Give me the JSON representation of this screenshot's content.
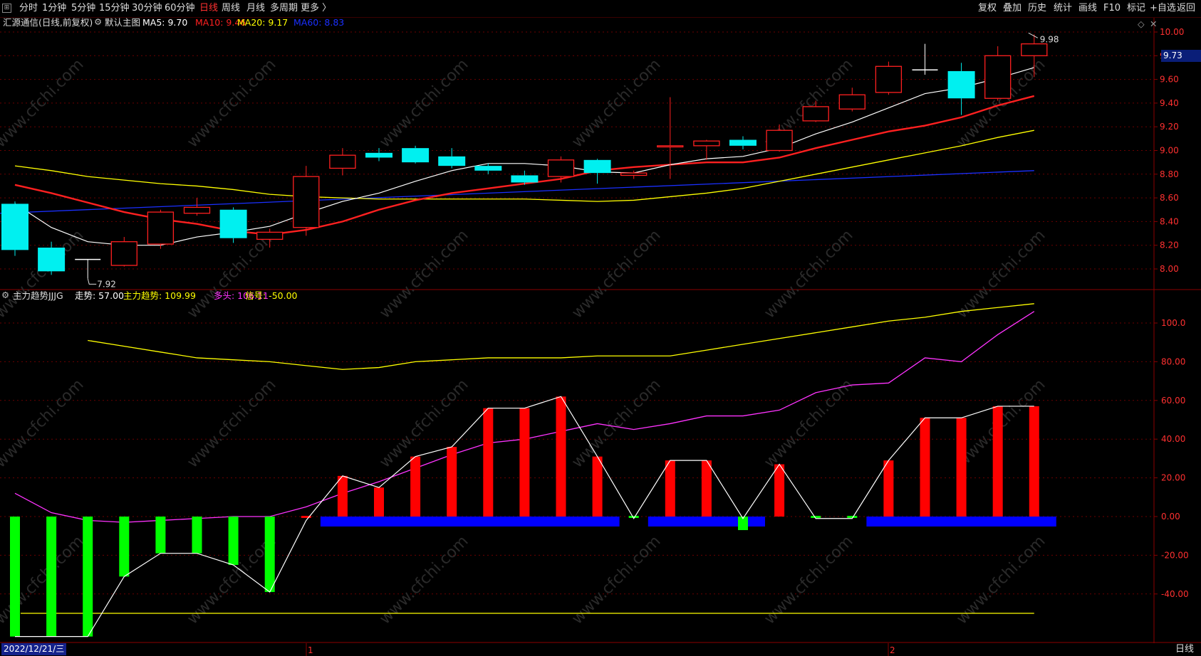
{
  "toolbar": {
    "periods": [
      "分时",
      "1分钟",
      "5分钟",
      "15分钟",
      "30分钟",
      "60分钟",
      "日线",
      "周线",
      "月线",
      "多周期",
      "更多 〉"
    ],
    "active_period": "日线",
    "right_items": [
      "复权",
      "叠加",
      "历史",
      "统计",
      "画线",
      "F10",
      "标记",
      "+自选",
      "返回"
    ]
  },
  "main_panel": {
    "title": "汇源通信(日线,前复权)",
    "indicator_name": "默认主图",
    "ma": [
      {
        "label": "MA5: 9.70",
        "color": "#ffffff"
      },
      {
        "label": "MA10: 9.46",
        "color": "#ff2020"
      },
      {
        "label": "MA20: 9.17",
        "color": "#ffff00"
      },
      {
        "label": "MA60: 8.83",
        "color": "#1a30ff"
      }
    ],
    "price_ticks": [
      "10.00",
      "9.80",
      "9.60",
      "9.40",
      "9.20",
      "9.00",
      "8.80",
      "8.60",
      "8.40",
      "8.20",
      "8.00"
    ],
    "current_price": "9.73",
    "high_mark": "9.98",
    "low_mark": "7.92"
  },
  "sub_panel": {
    "indicator_name": "主力趋势JJJG",
    "labels": [
      {
        "label": "走势: 57.00",
        "color": "#ffffff"
      },
      {
        "label": "主力趋势: 109.99",
        "color": "#ffff00"
      },
      {
        "label": "多头: 106.11",
        "color": "#ff33ff"
      },
      {
        "label": "信号: -50.00",
        "color": "#ffff00"
      }
    ],
    "ticks": [
      "100.0",
      "80.00",
      "60.00",
      "40.00",
      "20.00",
      "0.00",
      "-20.00",
      "-40.00"
    ]
  },
  "footer": {
    "date": "2022/12/21/三",
    "month_marks": [
      "1",
      "2"
    ],
    "period_tab": "日线"
  },
  "watermark": "www.cfchi.com",
  "colors": {
    "up": "#ff2020",
    "down": "#00f0f0",
    "bg": "#000000",
    "grid": "#6b0000",
    "pos_bar": "#ff0000",
    "neg_bar": "#00ff00",
    "signal_bar": "#0000ff"
  },
  "chart_data": {
    "type": "candlestick",
    "candles": [
      {
        "o": 8.55,
        "c": 8.16,
        "h": 8.57,
        "l": 8.11
      },
      {
        "o": 8.18,
        "c": 7.98,
        "h": 8.23,
        "l": 7.95
      },
      {
        "o": 8.08,
        "c": 8.08,
        "h": 8.08,
        "l": 7.92
      },
      {
        "o": 8.03,
        "c": 8.23,
        "h": 8.27,
        "l": 8.02
      },
      {
        "o": 8.21,
        "c": 8.48,
        "h": 8.5,
        "l": 8.17
      },
      {
        "o": 8.47,
        "c": 8.52,
        "h": 8.6,
        "l": 8.45
      },
      {
        "o": 8.5,
        "c": 8.26,
        "h": 8.52,
        "l": 8.22
      },
      {
        "o": 8.25,
        "c": 8.31,
        "h": 8.34,
        "l": 8.18
      },
      {
        "o": 8.35,
        "c": 8.78,
        "h": 8.87,
        "l": 8.28
      },
      {
        "o": 8.85,
        "c": 8.96,
        "h": 9.02,
        "l": 8.79
      },
      {
        "o": 8.98,
        "c": 8.94,
        "h": 9.02,
        "l": 8.91
      },
      {
        "o": 9.02,
        "c": 8.9,
        "h": 9.04,
        "l": 8.89
      },
      {
        "o": 8.95,
        "c": 8.87,
        "h": 9.02,
        "l": 8.85
      },
      {
        "o": 8.87,
        "c": 8.83,
        "h": 8.89,
        "l": 8.8
      },
      {
        "o": 8.79,
        "c": 8.73,
        "h": 8.83,
        "l": 8.71
      },
      {
        "o": 8.78,
        "c": 8.92,
        "h": 8.95,
        "l": 8.73
      },
      {
        "o": 8.92,
        "c": 8.81,
        "h": 8.93,
        "l": 8.72
      },
      {
        "o": 8.79,
        "c": 8.81,
        "h": 8.83,
        "l": 8.76
      },
      {
        "o": 9.03,
        "c": 9.04,
        "h": 9.45,
        "l": 8.76
      },
      {
        "o": 9.04,
        "c": 9.08,
        "h": 9.09,
        "l": 8.92
      },
      {
        "o": 9.09,
        "c": 9.04,
        "h": 9.12,
        "l": 9.01
      },
      {
        "o": 9.0,
        "c": 9.17,
        "h": 9.22,
        "l": 8.99
      },
      {
        "o": 9.25,
        "c": 9.37,
        "h": 9.42,
        "l": 9.24
      },
      {
        "o": 9.35,
        "c": 9.47,
        "h": 9.53,
        "l": 9.33
      },
      {
        "o": 9.49,
        "c": 9.71,
        "h": 9.75,
        "l": 9.47
      },
      {
        "o": 9.68,
        "c": 9.68,
        "h": 9.9,
        "l": 9.64
      },
      {
        "o": 9.67,
        "c": 9.44,
        "h": 9.74,
        "l": 9.3
      },
      {
        "o": 9.44,
        "c": 9.8,
        "h": 9.88,
        "l": 9.42
      },
      {
        "o": 9.8,
        "c": 9.9,
        "h": 9.98,
        "l": 9.62
      }
    ],
    "ma5": [
      8.55,
      8.35,
      8.23,
      8.2,
      8.2,
      8.27,
      8.31,
      8.36,
      8.47,
      8.57,
      8.64,
      8.74,
      8.83,
      8.89,
      8.89,
      8.87,
      8.82,
      8.81,
      8.88,
      8.93,
      8.95,
      9.02,
      9.14,
      9.24,
      9.36,
      9.48,
      9.53,
      9.61,
      9.7
    ],
    "ma10": [
      8.71,
      8.64,
      8.56,
      8.48,
      8.42,
      8.38,
      8.32,
      8.29,
      8.33,
      8.4,
      8.5,
      8.58,
      8.64,
      8.68,
      8.72,
      8.76,
      8.83,
      8.86,
      8.88,
      8.9,
      8.9,
      8.94,
      9.02,
      9.09,
      9.16,
      9.21,
      9.28,
      9.38,
      9.46
    ],
    "ma20": [
      8.87,
      8.83,
      8.78,
      8.75,
      8.72,
      8.7,
      8.67,
      8.63,
      8.61,
      8.6,
      8.59,
      8.59,
      8.59,
      8.59,
      8.59,
      8.58,
      8.57,
      8.58,
      8.61,
      8.64,
      8.68,
      8.74,
      8.8,
      8.86,
      8.92,
      8.98,
      9.04,
      9.11,
      9.17
    ],
    "ma60_ends": [
      8.47,
      8.83
    ],
    "trend_bars": [
      -62,
      -62,
      -62,
      -31,
      -19,
      -19,
      -25,
      -39,
      0,
      21,
      15,
      31,
      36,
      56,
      56,
      62,
      31,
      0,
      29,
      29,
      -7,
      27,
      0,
      0,
      29,
      51,
      51,
      57,
      57
    ],
    "trend_line": [
      -62,
      -62,
      -62,
      -31,
      -19,
      -19,
      -25,
      -39,
      -2,
      21,
      15,
      31,
      36,
      56,
      56,
      62,
      31,
      -1,
      29,
      29,
      -1,
      27,
      -1,
      -1,
      29,
      51,
      51,
      57,
      57
    ],
    "main_trend": [
      91,
      88,
      85,
      82,
      81,
      80,
      78,
      76,
      77,
      80,
      81,
      82,
      82,
      82,
      83,
      83,
      83,
      86,
      89,
      92,
      95,
      98,
      101,
      103,
      106,
      108,
      110
    ],
    "long_line": [
      12,
      2,
      -2,
      -3,
      -2,
      -1,
      0,
      0,
      5,
      12,
      18,
      25,
      32,
      38,
      40,
      44,
      48,
      45,
      48,
      52,
      52,
      55,
      64,
      68,
      69,
      82,
      80,
      94,
      106
    ],
    "signal_level": -50,
    "signal_segments": [
      [
        9,
        16
      ],
      [
        18,
        20
      ],
      [
        24,
        28
      ]
    ]
  }
}
